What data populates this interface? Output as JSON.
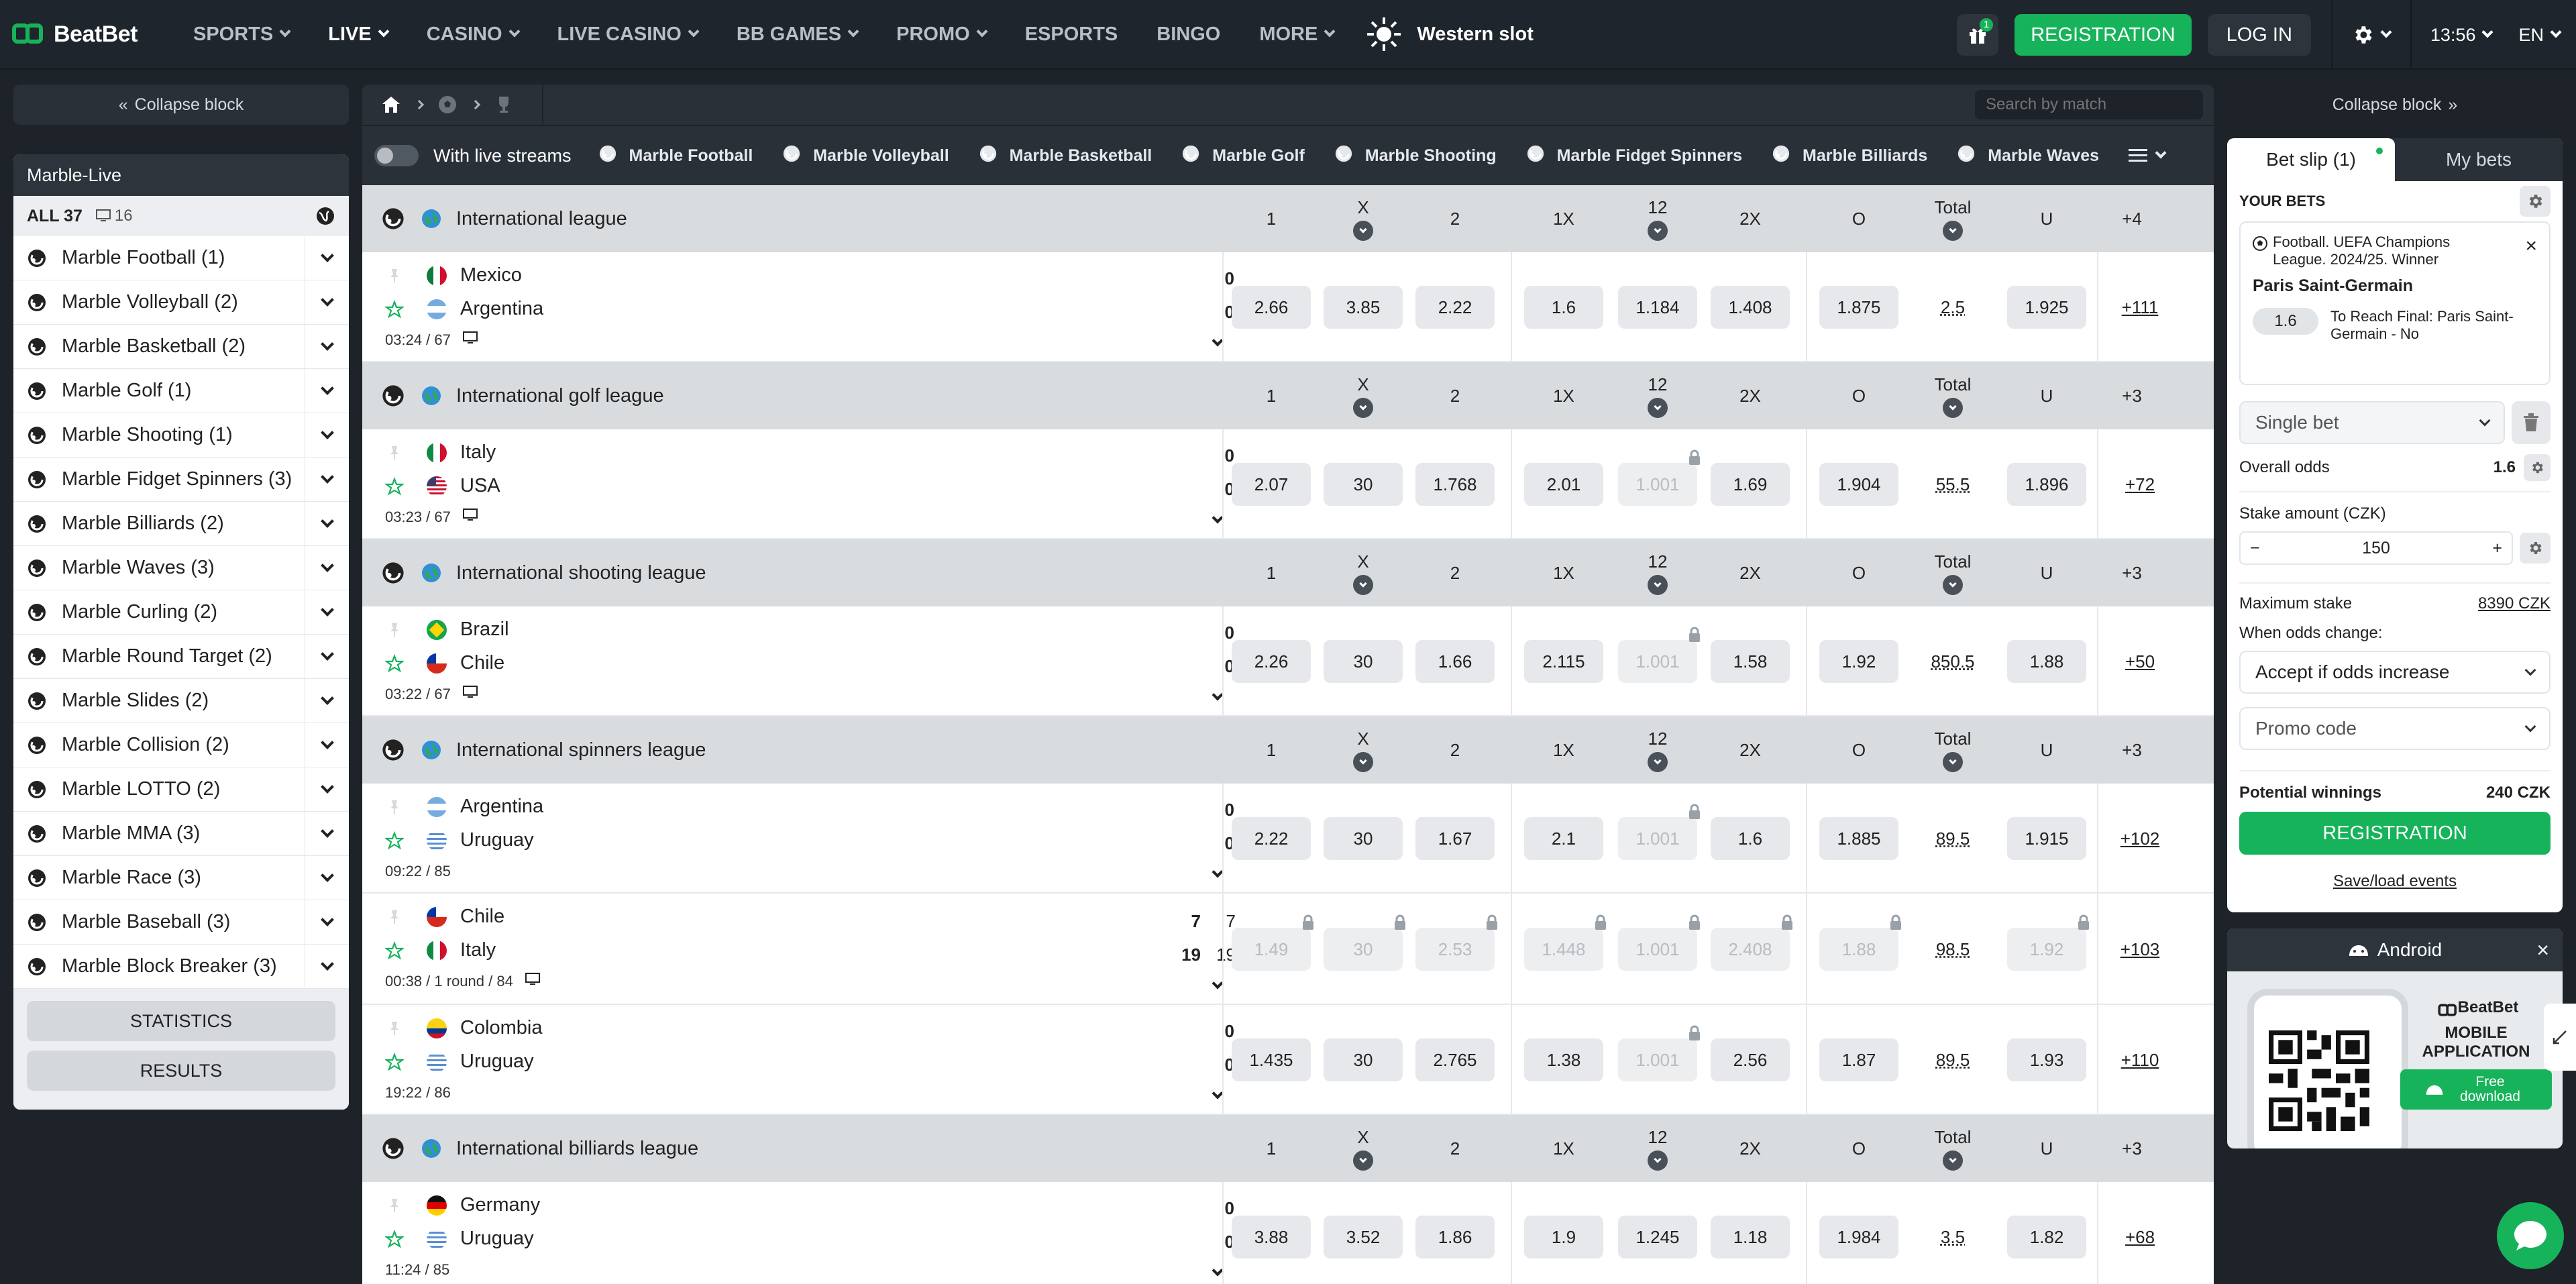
{
  "brand": {
    "name": "BeatBet",
    "accent": "#17b35a"
  },
  "nav": {
    "items": [
      {
        "label": "SPORTS",
        "dropdown": true,
        "active": false
      },
      {
        "label": "LIVE",
        "dropdown": true,
        "active": true
      },
      {
        "label": "CASINO",
        "dropdown": true,
        "active": false
      },
      {
        "label": "LIVE CASINO",
        "dropdown": true,
        "active": false
      },
      {
        "label": "BB GAMES",
        "dropdown": true,
        "active": false
      },
      {
        "label": "PROMO",
        "dropdown": true,
        "active": false
      },
      {
        "label": "ESPORTS",
        "dropdown": false,
        "active": false
      },
      {
        "label": "BINGO",
        "dropdown": false,
        "active": false
      },
      {
        "label": "MORE",
        "dropdown": true,
        "active": false
      }
    ],
    "promo_slot": "Western slot",
    "gift_badge": "1",
    "registration": "REGISTRATION",
    "login": "LOG IN",
    "time": "13:56",
    "lang": "EN"
  },
  "left": {
    "collapse": "Collapse block",
    "header": "Marble-Live",
    "all_label": "ALL 37",
    "stream_count": "16",
    "sports": [
      "Marble Football (1)",
      "Marble Volleyball (2)",
      "Marble Basketball (2)",
      "Marble Golf (1)",
      "Marble Shooting (1)",
      "Marble Fidget Spinners (3)",
      "Marble Billiards (2)",
      "Marble Waves (3)",
      "Marble Curling (2)",
      "Marble Round Target (2)",
      "Marble Slides (2)",
      "Marble Collision (2)",
      "Marble LOTTO (2)",
      "Marble MMA (3)",
      "Marble Race (3)",
      "Marble Baseball (3)",
      "Marble Block Breaker (3)"
    ],
    "statistics": "STATISTICS",
    "results": "RESULTS"
  },
  "center": {
    "search_placeholder": "Search by match",
    "with_streams": "With live streams",
    "tabs": [
      "Marble Football",
      "Marble Volleyball",
      "Marble Basketball",
      "Marble Golf",
      "Marble Shooting",
      "Marble Fidget Spinners",
      "Marble Billiards",
      "Marble Waves"
    ],
    "columns": [
      "1",
      "X",
      "2",
      "1X",
      "12",
      "2X",
      "O",
      "Total",
      "U"
    ],
    "leagues": [
      {
        "name": "International league",
        "more": "+4",
        "matches": [
          {
            "home": "Mexico",
            "away": "Argentina",
            "hflag": "mx",
            "aflag": "ar",
            "hs": "0",
            "as": "0",
            "time": "03:24 / 67",
            "tv": true,
            "odds": [
              "2.66",
              "3.85",
              "2.22",
              "1.6",
              "1.184",
              "1.408",
              "1.875"
            ],
            "locked": [],
            "total": "2.5",
            "u": "1.925",
            "u_locked": false,
            "more": "+111"
          }
        ]
      },
      {
        "name": "International golf league",
        "more": "+3",
        "matches": [
          {
            "home": "Italy",
            "away": "USA",
            "hflag": "it",
            "aflag": "us",
            "hs": "0",
            "as": "0",
            "time": "03:23 / 67",
            "tv": true,
            "odds": [
              "2.07",
              "30",
              "1.768",
              "2.01",
              "1.001",
              "1.69",
              "1.904"
            ],
            "locked": [
              4
            ],
            "total": "55.5",
            "u": "1.896",
            "u_locked": false,
            "more": "+72"
          }
        ]
      },
      {
        "name": "International shooting league",
        "more": "+3",
        "matches": [
          {
            "home": "Brazil",
            "away": "Chile",
            "hflag": "br",
            "aflag": "cl",
            "hs": "0",
            "as": "0",
            "time": "03:22 / 67",
            "tv": true,
            "odds": [
              "2.26",
              "30",
              "1.66",
              "2.115",
              "1.001",
              "1.58",
              "1.92"
            ],
            "locked": [
              4
            ],
            "total": "850.5",
            "u": "1.88",
            "u_locked": false,
            "more": "+50"
          }
        ]
      },
      {
        "name": "International spinners league",
        "more": "+3",
        "matches": [
          {
            "home": "Argentina",
            "away": "Uruguay",
            "hflag": "ar",
            "aflag": "uy",
            "hs": "0",
            "as": "0",
            "time": "09:22 / 85",
            "tv": false,
            "odds": [
              "2.22",
              "30",
              "1.67",
              "2.1",
              "1.001",
              "1.6",
              "1.885"
            ],
            "locked": [
              4
            ],
            "total": "89.5",
            "u": "1.915",
            "u_locked": false,
            "more": "+102"
          },
          {
            "home": "Chile",
            "away": "Italy",
            "hflag": "cl",
            "aflag": "it",
            "hs": "7",
            "as": "19",
            "hs2": "7",
            "as2": "19",
            "time": "00:38 / 1 round / 84",
            "tv": true,
            "odds": [
              "1.49",
              "30",
              "2.53",
              "1.448",
              "1.001",
              "2.408",
              "1.88"
            ],
            "locked": [
              0,
              1,
              2,
              3,
              4,
              5,
              6
            ],
            "total": "98.5",
            "u": "1.92",
            "u_locked": true,
            "more": "+103"
          },
          {
            "home": "Colombia",
            "away": "Uruguay",
            "hflag": "co",
            "aflag": "uy",
            "hs": "0",
            "as": "0",
            "time": "19:22 / 86",
            "tv": false,
            "odds": [
              "1.435",
              "30",
              "2.765",
              "1.38",
              "1.001",
              "2.56",
              "1.87"
            ],
            "locked": [
              4
            ],
            "total": "89.5",
            "u": "1.93",
            "u_locked": false,
            "more": "+110"
          }
        ]
      },
      {
        "name": "International billiards league",
        "more": "+3",
        "matches": [
          {
            "home": "Germany",
            "away": "Uruguay",
            "hflag": "de",
            "aflag": "uy",
            "hs": "0",
            "as": "0",
            "time": "11:24 / 85",
            "tv": false,
            "odds": [
              "3.88",
              "3.52",
              "1.86",
              "1.9",
              "1.245",
              "1.18",
              "1.984"
            ],
            "locked": [],
            "total": "3.5",
            "u": "1.82",
            "u_locked": false,
            "more": "+68"
          }
        ]
      }
    ]
  },
  "right": {
    "collapse": "Collapse block",
    "tab_slip": "Bet slip (1)",
    "tab_mybets": "My bets",
    "your_bets": "YOUR BETS",
    "bet_league": "Football. UEFA Champions League. 2024/25. Winner",
    "bet_selection": "Paris Saint-Germain",
    "bet_odd": "1.6",
    "bet_market": "To Reach Final: Paris Saint-Germain - No",
    "bet_type": "Single bet",
    "overall_odds_label": "Overall odds",
    "overall_odds": "1.6",
    "stake_label": "Stake amount (CZK)",
    "stake": "150",
    "max_stake_label": "Maximum stake",
    "max_stake": "8390 CZK",
    "odds_change_label": "When odds change:",
    "odds_change": "Accept if odds increase",
    "promo_code": "Promo code",
    "potential_label": "Potential winnings",
    "potential": "240 CZK",
    "register": "REGISTRATION",
    "save_load": "Save/load events"
  },
  "android": {
    "title": "Android",
    "brand": "BeatBet",
    "app_title": "MOBILE APPLICATION",
    "free_download": "Free download"
  }
}
